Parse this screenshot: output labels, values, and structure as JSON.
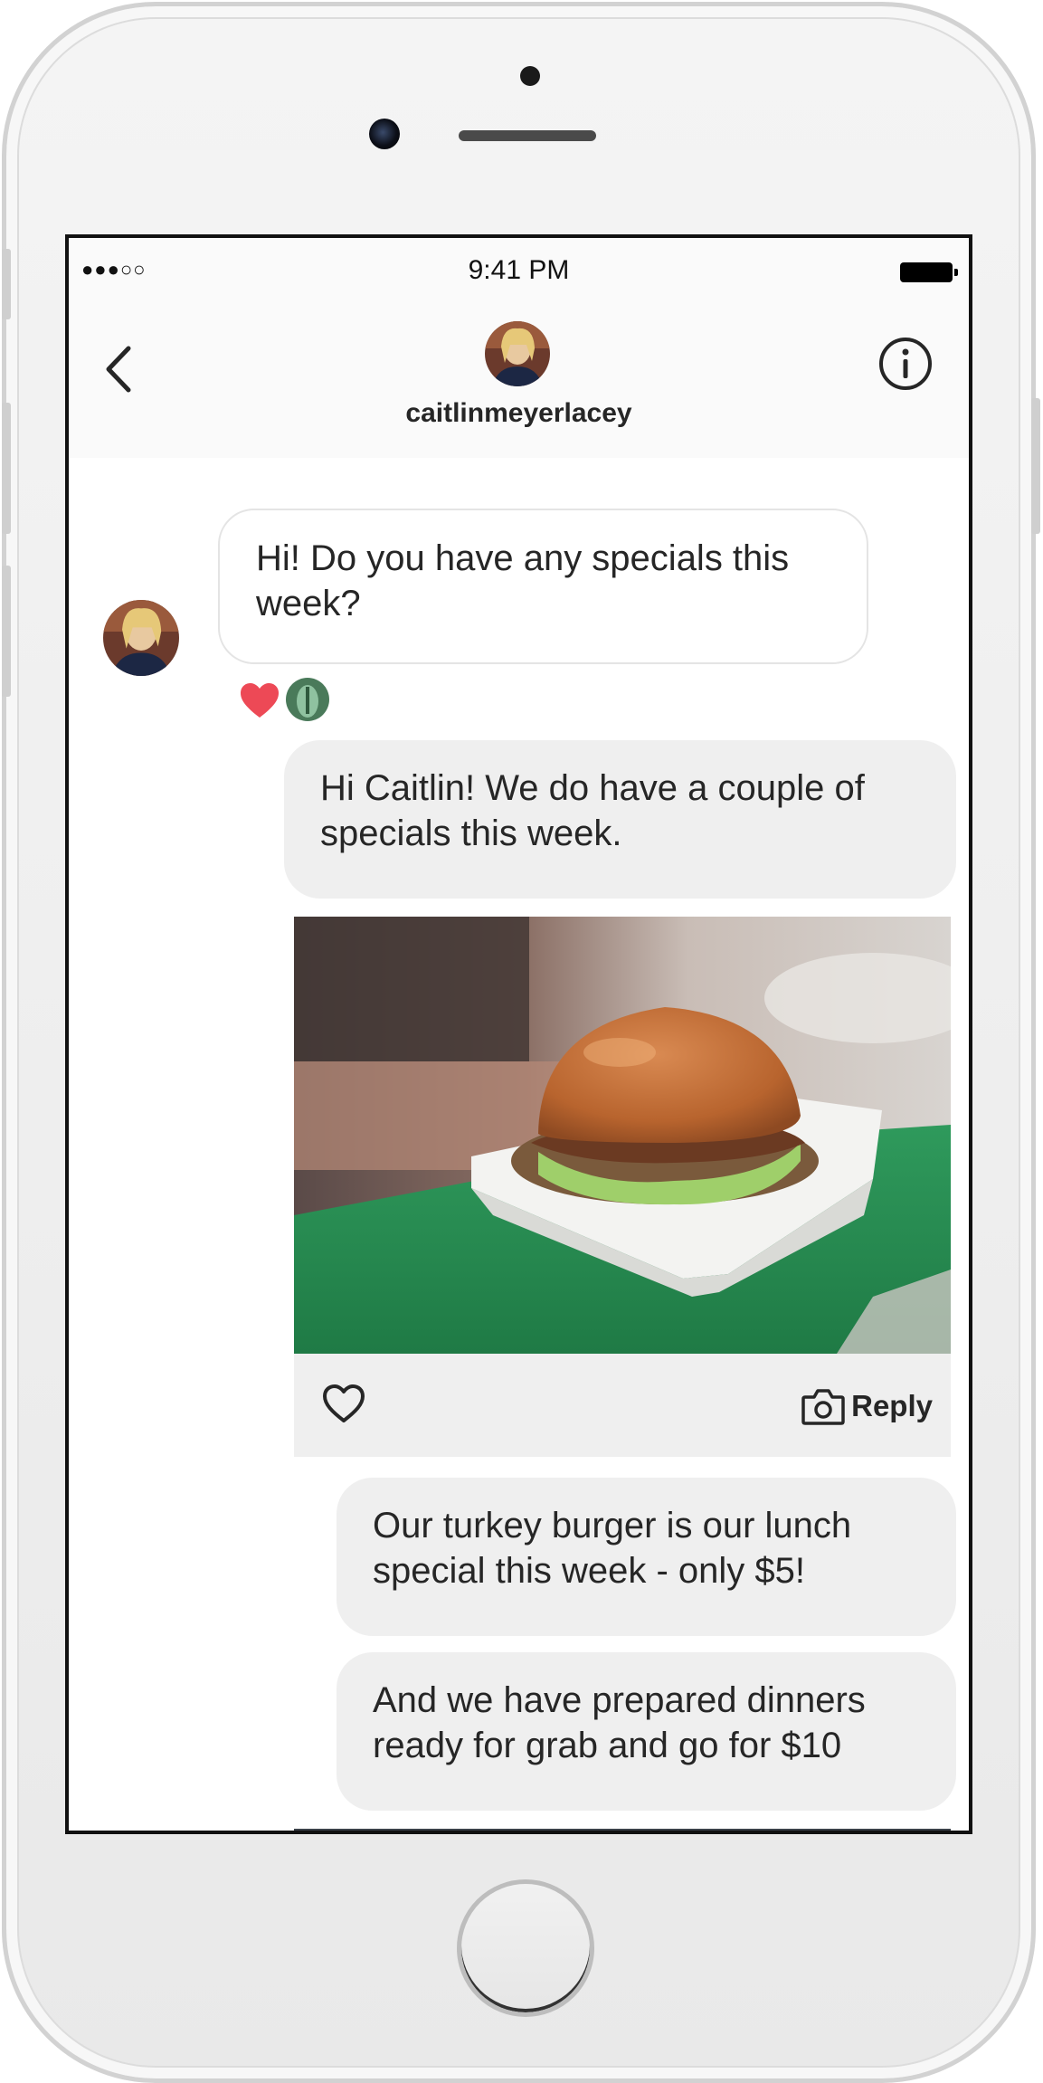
{
  "status_bar": {
    "signal": "●●●○○",
    "time": "9:41 PM"
  },
  "header": {
    "username": "caitlinmeyerlacey"
  },
  "messages": {
    "incoming_1": "Hi! Do you have any specials this week?",
    "outgoing_1": "Hi Caitlin! We do have a couple of specials this week.",
    "photo_reply_label": "Reply",
    "outgoing_2": "Our turkey burger is our lunch  special this week - only $5!",
    "outgoing_3": "And we have prepared dinners ready for grab and go for $10"
  },
  "colors": {
    "reaction_heart": "#ed4956",
    "outgoing_bubble": "#efefef",
    "incoming_border": "#e4e4e4",
    "text": "#262626"
  },
  "icons": {
    "back": "chevron-left-icon",
    "info": "info-circle-icon",
    "like": "heart-outline-icon",
    "reply": "camera-icon",
    "reaction": "heart-filled-icon"
  }
}
